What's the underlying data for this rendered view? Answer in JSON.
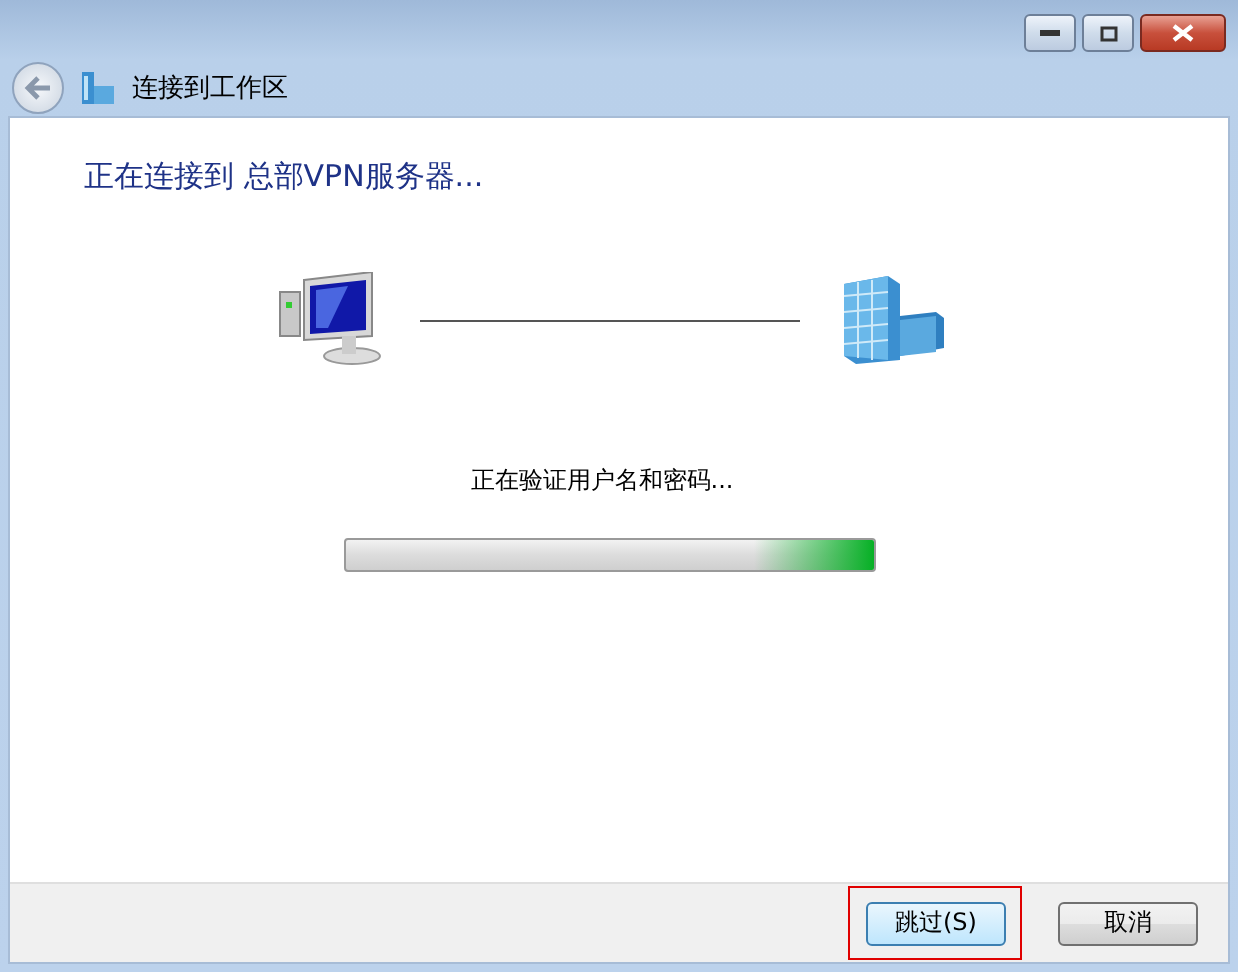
{
  "window": {
    "title": "连接到工作区"
  },
  "heading": "正在连接到 总部VPN服务器...",
  "status": "正在验证用户名和密码...",
  "progress": {
    "kind": "marquee",
    "level": 1
  },
  "buttons": [
    {
      "label": "跳过(S)",
      "default": true,
      "highlighted": true
    },
    {
      "label": "取消",
      "default": false,
      "highlighted": false
    }
  ]
}
